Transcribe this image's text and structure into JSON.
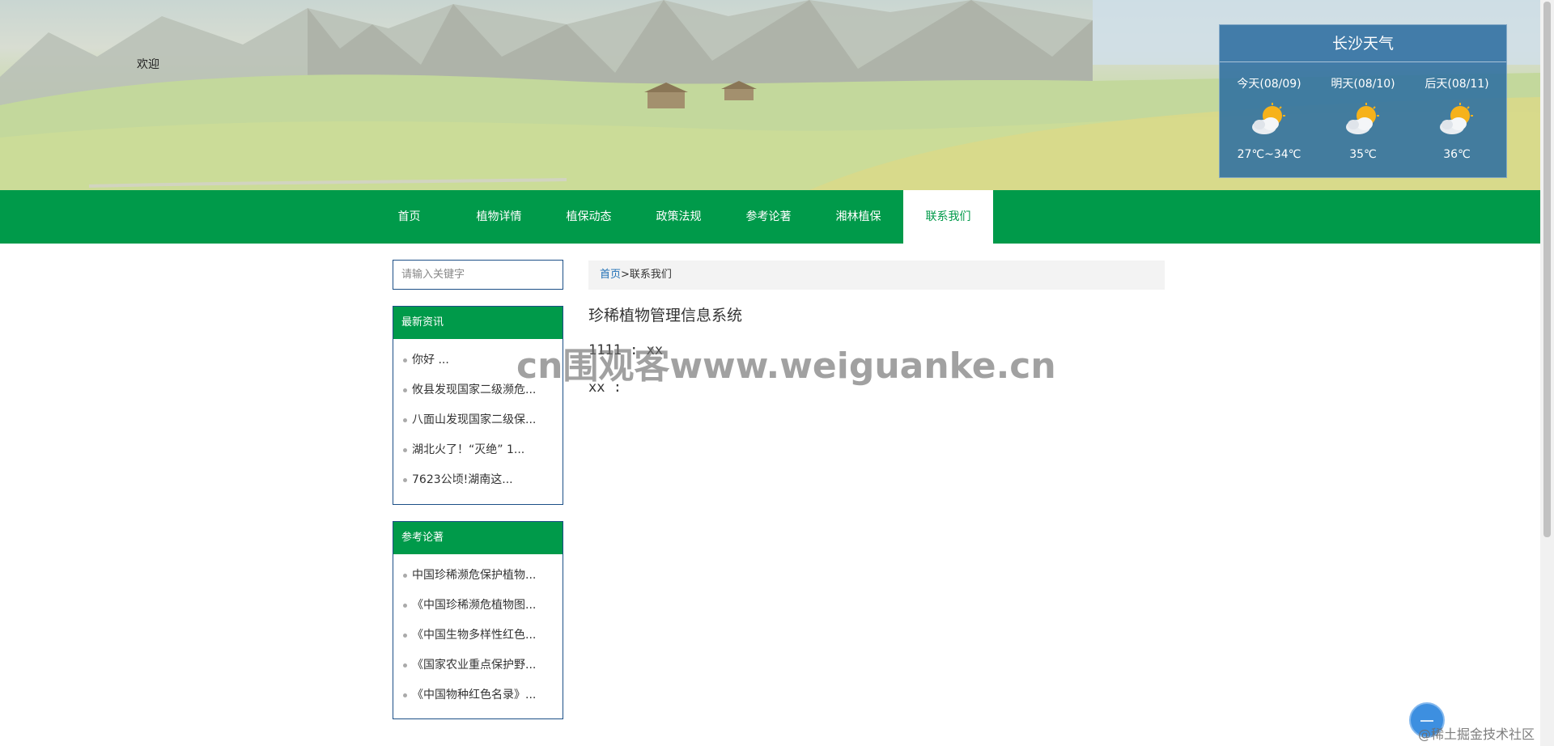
{
  "header": {
    "welcome_text": "欢迎"
  },
  "weather": {
    "title": "长沙天气",
    "days": [
      {
        "label": "今天(08/09)",
        "temp": "27℃~34℃",
        "icon": "partly-cloudy-sun-icon"
      },
      {
        "label": "明天(08/10)",
        "temp": "35℃",
        "icon": "partly-cloudy-sun-icon"
      },
      {
        "label": "后天(08/11)",
        "temp": "36℃",
        "icon": "partly-cloudy-sun-icon"
      }
    ]
  },
  "nav": {
    "items": [
      {
        "label": "首页",
        "active": false
      },
      {
        "label": "植物详情",
        "active": false
      },
      {
        "label": "植保动态",
        "active": false
      },
      {
        "label": "政策法规",
        "active": false
      },
      {
        "label": "参考论著",
        "active": false
      },
      {
        "label": "湘林植保",
        "active": false
      },
      {
        "label": "联系我们",
        "active": true
      }
    ]
  },
  "sidebar": {
    "search_placeholder": "请输入关键字",
    "news": {
      "title": "最新资讯",
      "items": [
        "你好 ...",
        "攸县发现国家二级濒危...",
        "八面山发现国家二级保...",
        "湖北火了！“灭绝” 1...",
        "7623公顷!湖南这..."
      ]
    },
    "works": {
      "title": "参考论著",
      "items": [
        "中国珍稀濒危保护植物...",
        "《中国珍稀濒危植物图...",
        "《中国生物多样性红色...",
        "《国家农业重点保护野...",
        "《中国物种红色名录》..."
      ]
    }
  },
  "breadcrumb": {
    "home": "首页",
    "separator": ">",
    "current": "联系我们"
  },
  "content": {
    "title": "珍稀植物管理信息系统",
    "line1": "1111 : xx",
    "line2": "xx :"
  },
  "overlay": {
    "watermark": "cn围观客www.weiguanke.cn",
    "credit": "@稀土掘金技术社区"
  },
  "colors": {
    "nav_green": "#009a4a",
    "weather_blue": "#2d6ea0",
    "link_blue": "#1f6fb5",
    "panel_border": "#1c4f87"
  }
}
